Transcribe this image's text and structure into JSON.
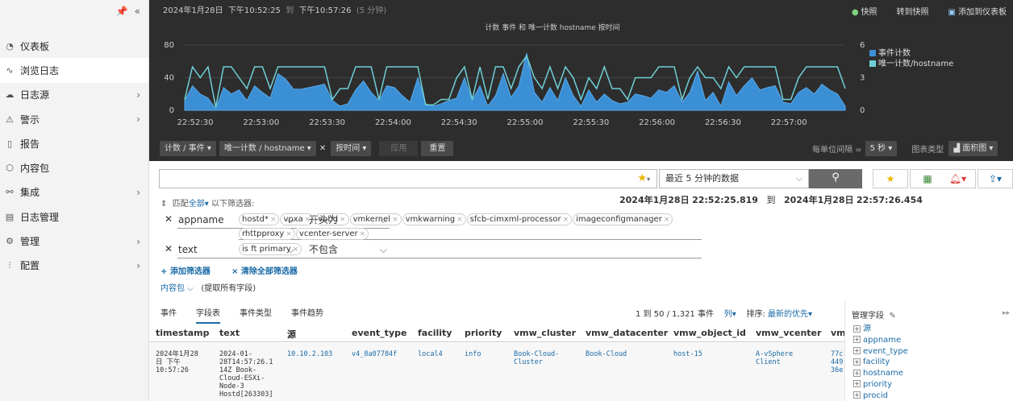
{
  "sidebar": {
    "items": [
      {
        "label": "仪表板",
        "icon": "dashboard-icon",
        "chevron": false,
        "active": false
      },
      {
        "label": "浏览日志",
        "icon": "chart-line-icon",
        "chevron": false,
        "active": true
      },
      {
        "label": "日志源",
        "icon": "cloud-icon",
        "chevron": true,
        "active": false
      },
      {
        "label": "警示",
        "icon": "warning-icon",
        "chevron": true,
        "active": false
      },
      {
        "label": "报告",
        "icon": "document-icon",
        "chevron": false,
        "active": false
      },
      {
        "label": "内容包",
        "icon": "package-icon",
        "chevron": false,
        "active": false
      },
      {
        "label": "集成",
        "icon": "integration-icon",
        "chevron": true,
        "active": false
      },
      {
        "label": "日志管理",
        "icon": "log-management-icon",
        "chevron": false,
        "active": false
      },
      {
        "label": "管理",
        "icon": "gear-icon",
        "chevron": true,
        "active": false
      },
      {
        "label": "配置",
        "icon": "sliders-icon",
        "chevron": true,
        "active": false
      }
    ]
  },
  "header": {
    "date": "2024年1月28日",
    "from": "下午10:52:25",
    "to_word": "到",
    "to": "下午10:57:26",
    "duration": "(5 分钟)",
    "snapshot": "快照",
    "goto_snapshot": "转到快照",
    "add_dashboard": "添加到仪表板"
  },
  "chart_title": "计数 事件 和 唯一计数 hostname 按时间",
  "legend": {
    "series1": "事件计数",
    "series2": "唯一计数/hostname"
  },
  "toolbar": {
    "count_events": "计数 / 事件",
    "unique_hostname": "唯一计数 / hostname",
    "by_time": "按时间",
    "apply": "应用",
    "reset": "重置",
    "interval_label": "每单位间隔 =",
    "interval_value": "5 秒",
    "chart_type_label": "图表类型",
    "chart_type_value": "面积图"
  },
  "search": {
    "placeholder": "",
    "time_range": "最近 5 分钟的数据"
  },
  "filters": {
    "match_label": "匹配",
    "match_value": "全部",
    "match_suffix": "以下筛选器:",
    "date_from": "2024年1月28日",
    "time_from": "22:52:25.819",
    "date_to_word": "到",
    "date_to": "2024年1月28日",
    "time_to": "22:57:26.454",
    "rows": [
      {
        "field": "appname",
        "op": "开头为",
        "values": [
          "hostd*",
          "vpxa",
          "vobd",
          "vmkernel",
          "vmkwarning",
          "sfcb-cimxml-processor",
          "imageconfigmanager",
          "rhttpproxy",
          "vcenter-server"
        ]
      },
      {
        "field": "text",
        "op": "不包含",
        "values": [
          "is ft primary"
        ]
      }
    ],
    "add_filter": "+ 添加筛选器",
    "clear_filters": "× 清除全部筛选器",
    "content_pack": "内容包",
    "content_pack_hint": "(提取所有字段)"
  },
  "tabs": [
    "事件",
    "字段表",
    "事件类型",
    "事件趋势"
  ],
  "active_tab": 1,
  "paging": {
    "range": "1 到 50 / 1,321 事件",
    "columns": "列",
    "sort_label": "排序:",
    "sort_value": "最新的优先"
  },
  "table": {
    "columns": [
      "timestamp",
      "text",
      "源",
      "event_type",
      "facility",
      "priority",
      "vmw_cluster",
      "vmw_datacenter",
      "vmw_object_id",
      "vmw_vcenter",
      "vmw"
    ],
    "row": {
      "timestamp": [
        "2024年1月28",
        "日 下午",
        "10:57:26"
      ],
      "text": [
        "2024-01-",
        "28T14:57:26.1",
        "14Z Book-",
        "Cloud-ESXi-",
        "Node-3",
        "Hostd[263303]"
      ],
      "source": "10.10.2.103",
      "event_type": "v4_8a07784f",
      "facility": "local4",
      "priority": "info",
      "vmw_cluster": [
        "Book-Cloud-",
        "Cluster"
      ],
      "vmw_datacenter": "Book-Cloud",
      "vmw_object_id": "host-15",
      "vmw_vcenter": [
        "A-vSphere",
        "Client"
      ],
      "vmw_more": [
        "77c",
        "449",
        "36e"
      ]
    }
  },
  "field_panel": {
    "title": "管理字段",
    "fields": [
      "源",
      "appname",
      "event_type",
      "facility",
      "hostname",
      "priority",
      "procid"
    ]
  },
  "chart_data": {
    "type": "area",
    "title": "计数 事件 和 唯一计数 hostname 按时间",
    "x_ticks": [
      "22:52:30",
      "22:53:00",
      "22:53:30",
      "22:54:00",
      "22:54:30",
      "22:55:00",
      "22:55:30",
      "22:56:00",
      "22:56:30",
      "22:57:00"
    ],
    "ylim_left": [
      0,
      80
    ],
    "yticks_left": [
      0,
      40,
      80
    ],
    "ylim_right": [
      0,
      6
    ],
    "yticks_right": [
      0,
      3,
      6
    ],
    "series": [
      {
        "name": "事件计数",
        "axis": "left",
        "color": "#3b8fd4",
        "values": [
          12,
          30,
          20,
          15,
          2,
          28,
          20,
          25,
          12,
          30,
          22,
          15,
          45,
          38,
          26,
          26,
          28,
          30,
          32,
          12,
          5,
          8,
          25,
          36,
          22,
          12,
          30,
          28,
          18,
          10,
          40,
          8,
          5,
          8,
          12,
          15,
          40,
          12,
          30,
          5,
          18,
          45,
          16,
          30,
          70,
          22,
          10,
          28,
          12,
          40,
          18,
          5,
          25,
          10,
          20,
          12,
          8,
          10,
          20,
          18,
          15,
          25,
          22,
          30,
          10,
          22,
          48,
          12,
          22,
          5,
          35,
          18,
          30,
          40,
          25,
          28,
          30,
          10,
          8,
          22,
          28,
          20,
          32,
          25,
          20,
          5
        ]
      },
      {
        "name": "唯一计数/hostname",
        "axis": "right",
        "color": "#6fd0d6",
        "values": [
          1,
          4,
          3,
          4,
          0.3,
          4,
          4,
          3,
          2,
          4,
          4,
          2,
          4,
          4,
          4,
          4,
          4,
          4,
          4,
          1,
          2,
          2,
          4,
          4,
          4,
          1,
          4,
          4,
          4,
          4,
          4,
          0.5,
          0.5,
          1,
          1,
          3,
          4,
          1,
          4,
          1,
          4,
          4,
          2,
          4,
          5,
          3,
          2,
          4,
          2,
          4,
          3,
          1,
          3,
          2,
          4,
          2,
          2,
          1,
          3,
          3,
          3,
          4,
          4,
          4,
          1,
          3,
          4,
          3,
          3,
          2,
          4,
          3,
          4,
          4,
          4,
          4,
          4,
          1,
          1,
          3,
          4,
          4,
          4,
          4,
          4,
          2
        ]
      }
    ]
  }
}
